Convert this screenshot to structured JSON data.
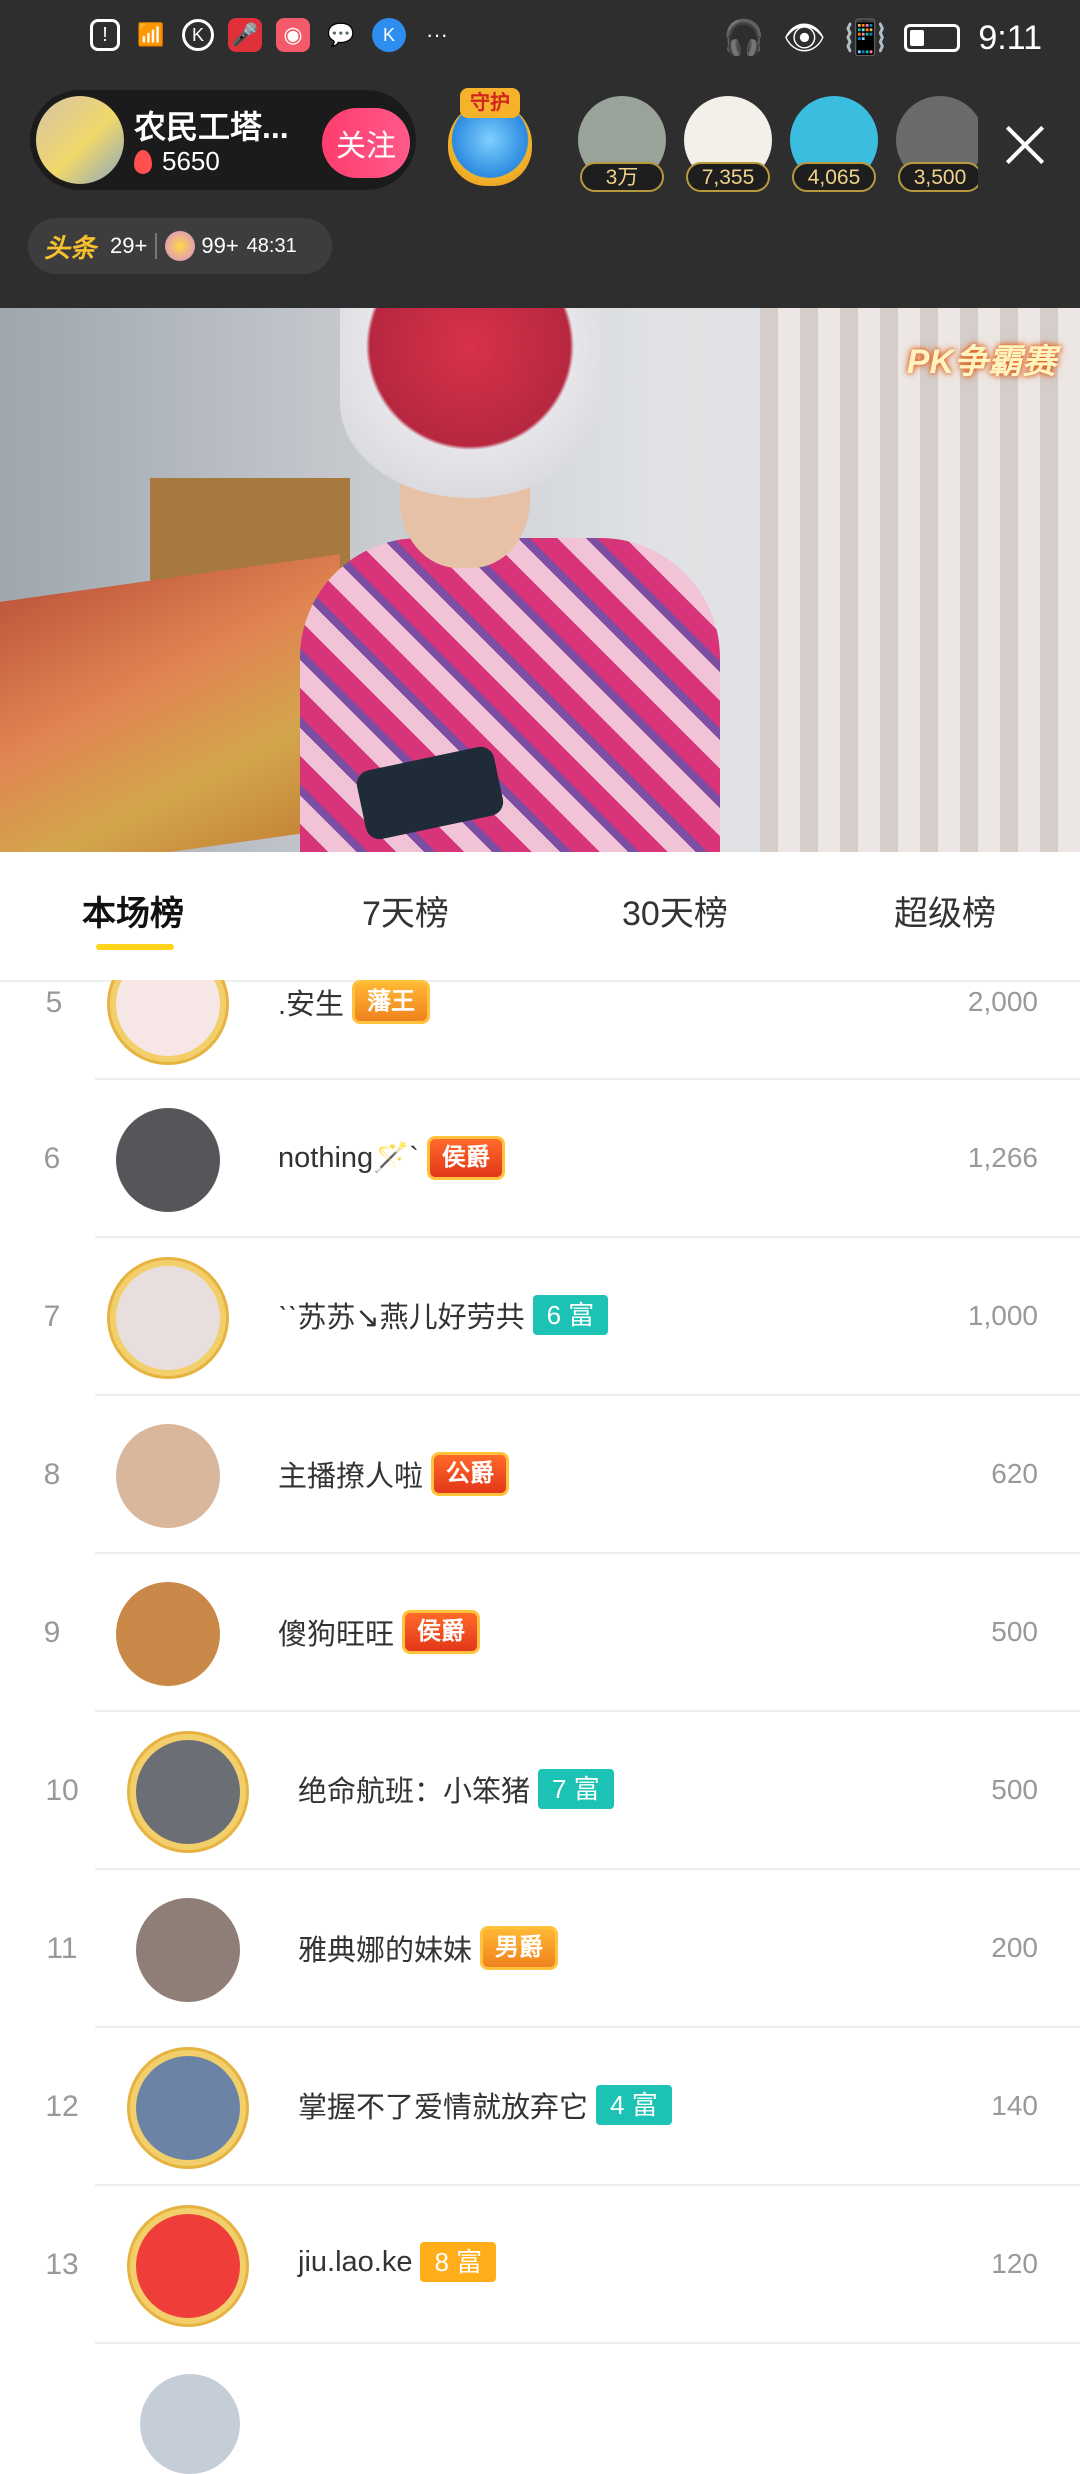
{
  "status_bar": {
    "time": "9:11",
    "left_icons": [
      "alert-icon",
      "wifi-icon",
      "k-app-icon",
      "mic-app-icon",
      "photo-app-icon",
      "wechat-icon",
      "k-blue-app-icon",
      "more-dots-icon"
    ],
    "right_icons": [
      "headphones-icon",
      "eye-icon",
      "vibrate-icon",
      "battery-icon"
    ]
  },
  "host": {
    "name": "农民工塔...",
    "heat": "5650",
    "follow_label": "关注"
  },
  "guard": {
    "label": "守护"
  },
  "viewers": [
    {
      "count": "3万",
      "color": "#9aa39a"
    },
    {
      "count": "7,355",
      "color": "#f3f0ea"
    },
    {
      "count": "4,065",
      "color": "#3bbde0"
    },
    {
      "count": "3,500",
      "color": "#6b6b6b"
    }
  ],
  "rank_pill": {
    "toutiao_label": "头条",
    "toutiao_count": "29+",
    "star_count": "99+",
    "timer": "48:31"
  },
  "video": {
    "pk_badge": "PK争霸赛"
  },
  "tabs": [
    {
      "label": "本场榜",
      "active": true
    },
    {
      "label": "7天榜",
      "active": false
    },
    {
      "label": "30天榜",
      "active": false
    },
    {
      "label": "超级榜",
      "active": false
    }
  ],
  "leaderboard": [
    {
      "rank": "5",
      "name": ".安生",
      "badge": "藩王",
      "badge_type": "noble-gold",
      "score": "2,000",
      "avatar_color": "#f6e6e6"
    },
    {
      "rank": "6",
      "name": "nothing🪄`",
      "badge": "侯爵",
      "badge_type": "noble",
      "score": "1,266",
      "avatar_color": "#55555a"
    },
    {
      "rank": "7",
      "name": "ˋˋ苏苏↘燕儿好劳共",
      "badge": "6 富",
      "badge_type": "rich",
      "score": "1,000",
      "avatar_color": "#e9dede"
    },
    {
      "rank": "8",
      "name": "主播撩人啦",
      "badge": "公爵",
      "badge_type": "noble",
      "score": "620",
      "avatar_color": "#d9b79d"
    },
    {
      "rank": "9",
      "name": "傻狗旺旺",
      "badge": "侯爵",
      "badge_type": "noble",
      "score": "500",
      "avatar_color": "#c98848"
    },
    {
      "rank": "10",
      "name": "绝命航班：小笨猪",
      "badge": "7 富",
      "badge_type": "rich",
      "score": "500",
      "avatar_color": "#6b6f75"
    },
    {
      "rank": "11",
      "name": "雅典娜的妹妹",
      "badge": "男爵",
      "badge_type": "noble-gold",
      "score": "200",
      "avatar_color": "#8f7d77"
    },
    {
      "rank": "12",
      "name": "掌握不了爱情就放弃它",
      "badge": "4 富",
      "badge_type": "rich",
      "score": "140",
      "avatar_color": "#6b84a6"
    },
    {
      "rank": "13",
      "name": "jiu.lao.ke",
      "badge": "8 富",
      "badge_type": "rich-orange",
      "score": "120",
      "avatar_color": "#ef3e3a"
    }
  ]
}
